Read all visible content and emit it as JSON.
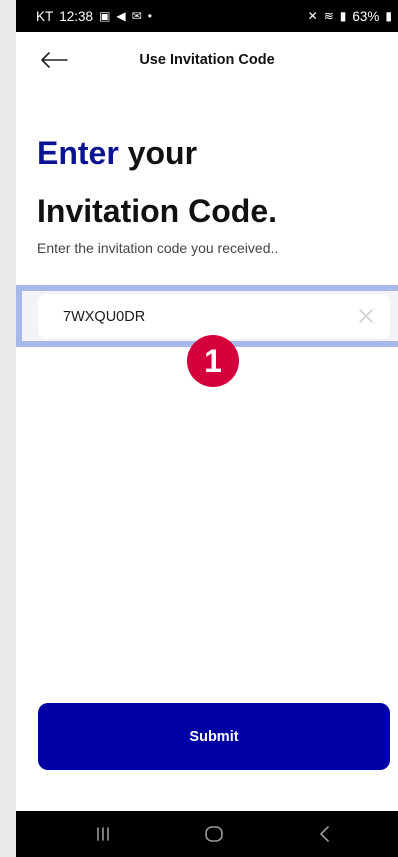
{
  "status_bar": {
    "carrier": "KT",
    "time": "12:38",
    "battery": "63%"
  },
  "header": {
    "title": "Use Invitation Code"
  },
  "heading": {
    "accent": "Enter",
    "line1_rest": " your",
    "line2": "Invitation Code."
  },
  "subtitle": "Enter the invitation code you received..",
  "input": {
    "value": "7WXQU0DR"
  },
  "annotation_badge": "1",
  "submit_label": "Submit",
  "icons": [
    "back-arrow-icon",
    "clear-icon",
    "nav-recents-icon",
    "nav-home-icon",
    "nav-back-icon"
  ],
  "colors": {
    "accent": "#0a1391",
    "button": "#0000a5",
    "highlight": "#a7b9ea",
    "badge": "#d4003c"
  }
}
